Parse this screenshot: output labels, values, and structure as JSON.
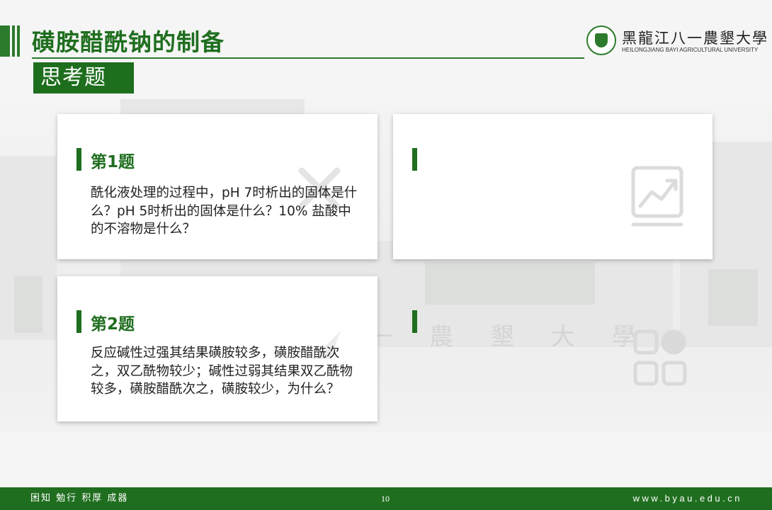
{
  "header": {
    "title": "磺胺醋酰钠的制备",
    "logo_cn": "黑龍江八一農墾大學",
    "logo_en": "HEILONGJIANG BAYI AGRICULTURAL UNIVERSITY"
  },
  "subtitle": "思考题",
  "background_text": "一農墾大學",
  "questions": [
    {
      "title": "第1题",
      "text": "酰化液处理的过程中，pH 7时析出的固体是什么？pH 5时析出的固体是什么？10% 盐酸中的不溶物是什么？"
    },
    {
      "title": "第2题",
      "text": "反应碱性过强其结果磺胺较多，磺胺醋酰次之，双乙酰物较少；碱性过弱其结果双乙酰物较多，磺胺醋酰次之，磺胺较少，为什么？"
    }
  ],
  "footer": {
    "motto": "困知 勉行 积厚 成器",
    "page_number": "10",
    "website": "www.byau.edu.cn"
  },
  "colors": {
    "brand_green": "#1f6e1f"
  },
  "icons": [
    "chart-icon",
    "grid-icon"
  ]
}
